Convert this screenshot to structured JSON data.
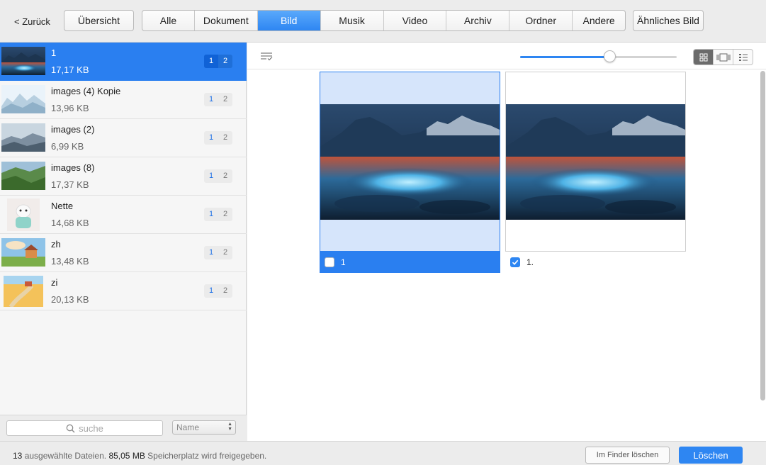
{
  "toolbar": {
    "back_label": "< Zurück",
    "overview_label": "Übersicht",
    "similar_label": "Ähnliches Bild",
    "segments": [
      {
        "label": "Alle",
        "active": false
      },
      {
        "label": "Dokument",
        "active": false
      },
      {
        "label": "Bild",
        "active": true
      },
      {
        "label": "Musik",
        "active": false
      },
      {
        "label": "Video",
        "active": false
      },
      {
        "label": "Archiv",
        "active": false
      },
      {
        "label": "Ordner",
        "active": false
      },
      {
        "label": "Andere",
        "active": false
      }
    ]
  },
  "sidebar": {
    "files": [
      {
        "name": "1",
        "size": "17,17 KB",
        "badge": [
          "1",
          "2"
        ],
        "selected": true,
        "thumb": "lake-night"
      },
      {
        "name": "images (4) Kopie",
        "size": "13,96 KB",
        "badge": [
          "1",
          "2"
        ],
        "selected": false,
        "thumb": "snow-mountains"
      },
      {
        "name": "images (2)",
        "size": "6,99 KB",
        "badge": [
          "1",
          "2"
        ],
        "selected": false,
        "thumb": "misty-hills"
      },
      {
        "name": "images (8)",
        "size": "17,37 KB",
        "badge": [
          "1",
          "2"
        ],
        "selected": false,
        "thumb": "green-hills"
      },
      {
        "name": "Nette",
        "size": "14,68 KB",
        "badge": [
          "1",
          "2"
        ],
        "selected": false,
        "thumb": "dog"
      },
      {
        "name": "zh",
        "size": "13,48 KB",
        "badge": [
          "1",
          "2"
        ],
        "selected": false,
        "thumb": "cottage"
      },
      {
        "name": "zi",
        "size": "20,13 KB",
        "badge": [
          "1",
          "2"
        ],
        "selected": false,
        "thumb": "flower-field"
      }
    ],
    "search_placeholder": "suche",
    "sort_value": "Name"
  },
  "main": {
    "zoom_level": 0.57,
    "views": [
      "grid-view-icon",
      "filmstrip-view-icon",
      "list-view-icon"
    ],
    "active_view": 0,
    "cards": [
      {
        "label": "1",
        "checked": false,
        "selected": true
      },
      {
        "label": "1.",
        "checked": true,
        "selected": false
      }
    ]
  },
  "status": {
    "count": "13",
    "count_text": " ausgewählte Dateien. ",
    "size": "85,05 MB",
    "size_text": " Speicherplatz wird freigegeben."
  },
  "actions": {
    "finder_label": "Im Finder löschen",
    "delete_label": "Löschen"
  },
  "colors": {
    "accent": "#2e86f2",
    "selection": "#2a7ff0"
  }
}
